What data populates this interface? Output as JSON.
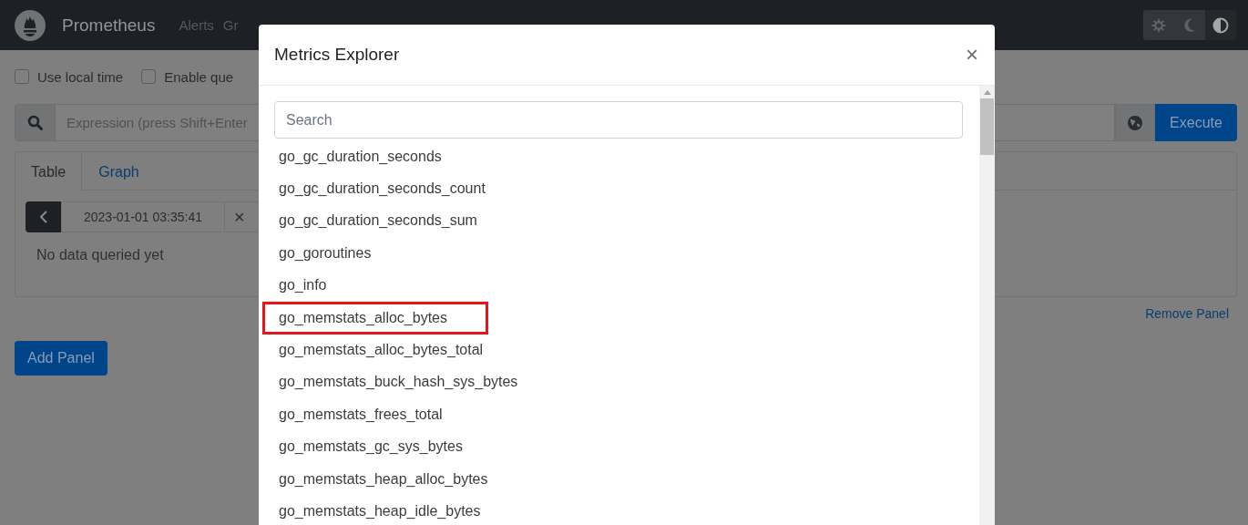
{
  "navbar": {
    "brand": "Prometheus",
    "links": [
      "Alerts",
      "Gr"
    ],
    "theme_buttons": [
      {
        "kind": "gear",
        "selected": false
      },
      {
        "kind": "moon",
        "selected": false
      },
      {
        "kind": "contrast",
        "selected": true
      }
    ]
  },
  "options": [
    {
      "label": "Use local time",
      "checked": false
    },
    {
      "label": "Enable que",
      "checked": false
    }
  ],
  "expression": {
    "placeholder": "Expression (press Shift+Enter",
    "execute": "Execute"
  },
  "panel": {
    "tabs": [
      {
        "label": "Table",
        "selected": true
      },
      {
        "label": "Graph",
        "selected": false
      }
    ],
    "time": "2023-01-01 03:35:41",
    "clear": "×",
    "empty": "No data queried yet",
    "remove": "Remove Panel"
  },
  "add_panel": "Add Panel",
  "modal": {
    "title": "Metrics Explorer",
    "close": "×",
    "search_placeholder": "Search",
    "metrics": [
      {
        "name": "go_gc_duration_seconds",
        "highlighted": false
      },
      {
        "name": "go_gc_duration_seconds_count",
        "highlighted": false
      },
      {
        "name": "go_gc_duration_seconds_sum",
        "highlighted": false
      },
      {
        "name": "go_goroutines",
        "highlighted": false
      },
      {
        "name": "go_info",
        "highlighted": false
      },
      {
        "name": "go_memstats_alloc_bytes",
        "highlighted": true
      },
      {
        "name": "go_memstats_alloc_bytes_total",
        "highlighted": false
      },
      {
        "name": "go_memstats_buck_hash_sys_bytes",
        "highlighted": false
      },
      {
        "name": "go_memstats_frees_total",
        "highlighted": false
      },
      {
        "name": "go_memstats_gc_sys_bytes",
        "highlighted": false
      },
      {
        "name": "go_memstats_heap_alloc_bytes",
        "highlighted": false
      },
      {
        "name": "go_memstats_heap_idle_bytes",
        "highlighted": false
      }
    ]
  }
}
